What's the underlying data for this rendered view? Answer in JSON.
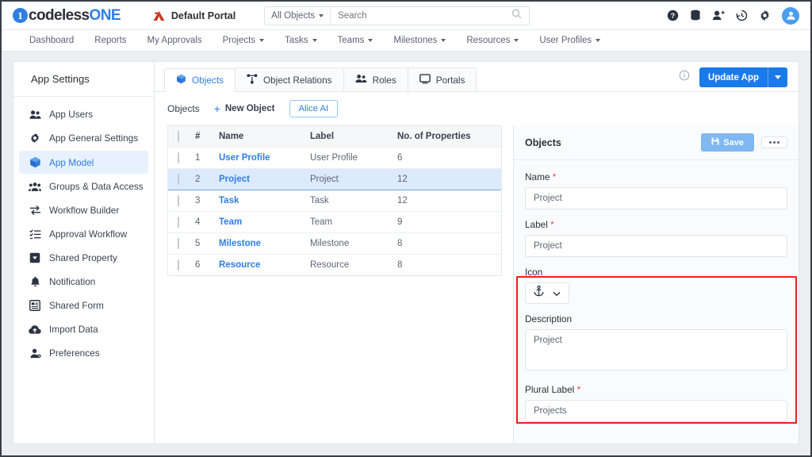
{
  "brand": {
    "name_part1": "codeless",
    "name_part2": "ONE",
    "mark": "1"
  },
  "topbar": {
    "portal_name": "Default Portal",
    "scope_label": "All Objects",
    "search_placeholder": "Search",
    "icons": [
      "help-circle-icon",
      "database-icon",
      "add-user-icon",
      "history-icon",
      "gear-icon",
      "avatar"
    ]
  },
  "nav": {
    "items": [
      {
        "label": "Dashboard",
        "has_caret": false
      },
      {
        "label": "Reports",
        "has_caret": false
      },
      {
        "label": "My Approvals",
        "has_caret": false
      },
      {
        "label": "Projects",
        "has_caret": true
      },
      {
        "label": "Tasks",
        "has_caret": true
      },
      {
        "label": "Teams",
        "has_caret": true
      },
      {
        "label": "Milestones",
        "has_caret": true
      },
      {
        "label": "Resources",
        "has_caret": true
      },
      {
        "label": "User Profiles",
        "has_caret": true
      }
    ]
  },
  "sidebar": {
    "title": "App Settings",
    "items": [
      {
        "label": "App Users",
        "icon": "users-icon",
        "active": false
      },
      {
        "label": "App General Settings",
        "icon": "gear-icon",
        "active": false
      },
      {
        "label": "App Model",
        "icon": "cube-icon",
        "active": true
      },
      {
        "label": "Groups & Data Access",
        "icon": "group-users-icon",
        "active": false
      },
      {
        "label": "Workflow Builder",
        "icon": "exchange-arrows-icon",
        "active": false
      },
      {
        "label": "Approval Workflow",
        "icon": "checklist-icon",
        "active": false
      },
      {
        "label": "Shared Property",
        "icon": "dropdown-box-icon",
        "active": false
      },
      {
        "label": "Notification",
        "icon": "bell-icon",
        "active": false
      },
      {
        "label": "Shared Form",
        "icon": "form-icon",
        "active": false
      },
      {
        "label": "Import Data",
        "icon": "cloud-upload-icon",
        "active": false
      },
      {
        "label": "Preferences",
        "icon": "user-settings-icon",
        "active": false
      }
    ]
  },
  "tabs": [
    {
      "label": "Objects",
      "icon": "cube-icon",
      "active": true
    },
    {
      "label": "Object Relations",
      "icon": "relations-icon",
      "active": false
    },
    {
      "label": "Roles",
      "icon": "users-icon",
      "active": false
    },
    {
      "label": "Portals",
      "icon": "monitor-icon",
      "active": false
    }
  ],
  "header_actions": {
    "info_icon": "info-circle-icon",
    "update_app_label": "Update App"
  },
  "toolbar": {
    "title": "Objects",
    "new_object_label": "New Object",
    "plus": "+",
    "alice_label": "Alice AI"
  },
  "table": {
    "columns": [
      "",
      "#",
      "Name",
      "Label",
      "No. of Properties"
    ],
    "rows": [
      {
        "num": "1",
        "name": "User Profile",
        "label": "User Profile",
        "props": "6",
        "selected": false
      },
      {
        "num": "2",
        "name": "Project",
        "label": "Project",
        "props": "12",
        "selected": true
      },
      {
        "num": "3",
        "name": "Task",
        "label": "Task",
        "props": "12",
        "selected": false
      },
      {
        "num": "4",
        "name": "Team",
        "label": "Team",
        "props": "9",
        "selected": false
      },
      {
        "num": "5",
        "name": "Milestone",
        "label": "Milestone",
        "props": "8",
        "selected": false
      },
      {
        "num": "6",
        "name": "Resource",
        "label": "Resource",
        "props": "8",
        "selected": false
      }
    ]
  },
  "panel": {
    "title": "Objects",
    "save_label": "Save",
    "more_label": "more-options",
    "fields": {
      "name_label": "Name",
      "name_value": "Project",
      "label_label": "Label",
      "label_value": "Project",
      "icon_label": "Icon",
      "icon_glyph": "anchor-icon",
      "description_label": "Description",
      "description_value": "Project",
      "plural_label": "Plural Label",
      "plural_value": "Projects"
    }
  },
  "colors": {
    "accent": "#2f7de1",
    "button_blue": "#1a7aeb",
    "save_blue": "#7fb8f2",
    "selected_row": "#dceafc",
    "highlight_box": "#f41d1d",
    "required": "#e8455a"
  }
}
